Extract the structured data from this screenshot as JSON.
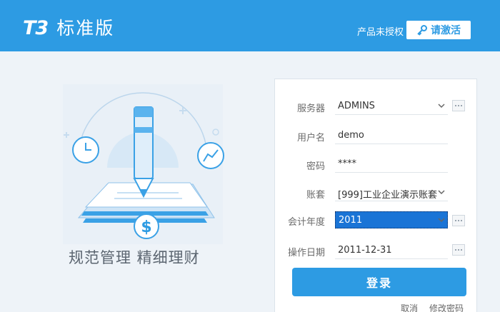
{
  "header": {
    "logo_t3": "T3",
    "logo_edition": "标准版",
    "unlicensed": "产品未授权",
    "activate_label": "请激活"
  },
  "slogan": "规范管理  精细理财",
  "form": {
    "server_label": "服务器",
    "server_value": "ADMINS",
    "user_label": "用户名",
    "user_value": "demo",
    "password_label": "密码",
    "password_value": "****",
    "account_label": "账套",
    "account_value": "[999]工业企业演示账套",
    "year_label": "会计年度",
    "year_value": "2011",
    "date_label": "操作日期",
    "date_value": "2011-12-31",
    "login_label": "登录",
    "cancel_label": "取消",
    "change_password_label": "修改密码"
  },
  "colors": {
    "brand": "#2d9be3",
    "selection": "#1a74d6"
  }
}
